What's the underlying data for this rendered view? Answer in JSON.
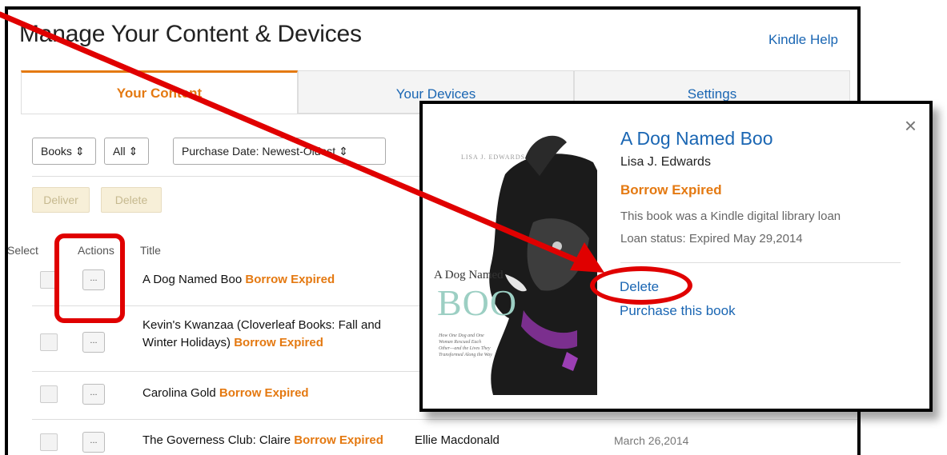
{
  "header": {
    "title": "Manage Your Content & Devices",
    "help_link": "Kindle Help"
  },
  "tabs": [
    {
      "label": "Your Content",
      "active": true
    },
    {
      "label": "Your Devices",
      "active": false
    },
    {
      "label": "Settings",
      "active": false
    }
  ],
  "filters": {
    "type": "Books",
    "show": "All",
    "sort": "Purchase Date: Newest-Oldest"
  },
  "bulk_actions": {
    "deliver": "Deliver",
    "delete": "Delete"
  },
  "columns": {
    "select": "Select",
    "actions": "Actions",
    "title": "Title"
  },
  "actions_button_label": "...",
  "rows": [
    {
      "title": "A Dog Named Boo",
      "status": "Borrow Expired",
      "author": "",
      "date": ""
    },
    {
      "title": "Kevin's Kwanzaa (Cloverleaf Books: Fall and Winter Holidays)",
      "title_line1": "Kevin's Kwanzaa (Cloverleaf Books: Fall and",
      "title_line2": "Winter Holidays)",
      "status": "Borrow Expired",
      "author": "",
      "date": ""
    },
    {
      "title": "Carolina Gold",
      "status": "Borrow Expired",
      "author": "",
      "date": ""
    },
    {
      "title": "The Governess Club: Claire",
      "status": "Borrow Expired",
      "author": "Ellie Macdonald",
      "date": "March 26,2014"
    }
  ],
  "popup": {
    "title": "A Dog Named Boo",
    "author": "Lisa J. Edwards",
    "status": "Borrow Expired",
    "description": "This book was a Kindle digital library loan",
    "loan_status": "Loan status: Expired May 29,2014",
    "delete_link": "Delete",
    "purchase_link": "Purchase this book",
    "close_glyph": "×",
    "cover": {
      "author": "LISA J. EDWARDS",
      "title_line1": "A Dog Named",
      "title_line2": "BOO",
      "subtitle": "How One Dog and One Woman Rescued Each Other—and the Lives They Transformed Along the Way"
    }
  },
  "colors": {
    "link": "#1a66b3",
    "accent_orange": "#e47911",
    "annotation_red": "#e00000"
  }
}
